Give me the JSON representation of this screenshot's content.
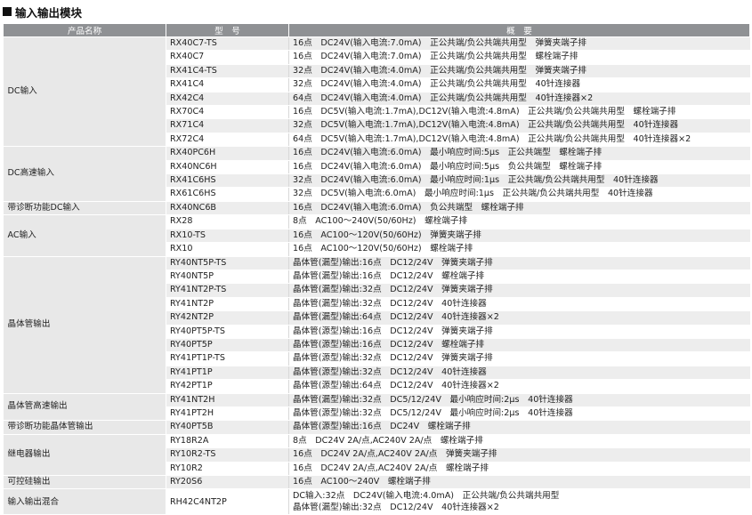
{
  "title": "输入输出模块",
  "headers": [
    "产品名称",
    "型　号",
    "概　要"
  ],
  "groups": [
    {
      "name": "DC输入",
      "rows": [
        {
          "model": "RX40C7-TS",
          "summary": [
            "16点　DC24V(输入电流:7.0mA)　正公共端/负公共端共用型　弹簧夹端子排"
          ]
        },
        {
          "model": "RX40C7",
          "summary": [
            "16点　DC24V(输入电流:7.0mA)　正公共端/负公共端共用型　螺栓端子排"
          ]
        },
        {
          "model": "RX41C4-TS",
          "summary": [
            "32点　DC24V(输入电流:4.0mA)　正公共端/负公共端共用型　弹簧夹端子排"
          ]
        },
        {
          "model": "RX41C4",
          "summary": [
            "32点　DC24V(输入电流:4.0mA)　正公共端/负公共端共用型　40针连接器"
          ]
        },
        {
          "model": "RX42C4",
          "summary": [
            "64点　DC24V(输入电流:4.0mA)　正公共端/负公共端共用型　40针连接器×2"
          ]
        },
        {
          "model": "RX70C4",
          "summary": [
            "16点　DC5V(输入电流:1.7mA),DC12V(输入电流:4.8mA)　正公共端/负公共端共用型　螺栓端子排"
          ]
        },
        {
          "model": "RX71C4",
          "summary": [
            "32点　DC5V(输入电流:1.7mA),DC12V(输入电流:4.8mA)　正公共端/负公共端共用型　40针连接器"
          ]
        },
        {
          "model": "RX72C4",
          "summary": [
            "64点　DC5V(输入电流:1.7mA),DC12V(输入电流:4.8mA)　正公共端/负公共端共用型　40针连接器×2"
          ]
        }
      ]
    },
    {
      "name": "DC高速输入",
      "rows": [
        {
          "model": "RX40PC6H",
          "summary": [
            "16点　DC24V(输入电流:6.0mA)　最小响应时间:5μs　正公共端型　螺栓端子排"
          ]
        },
        {
          "model": "RX40NC6H",
          "summary": [
            "16点　DC24V(输入电流:6.0mA)　最小响应时间:5μs　负公共端型　螺栓端子排"
          ]
        },
        {
          "model": "RX41C6HS",
          "summary": [
            "32点　DC24V(输入电流:6.0mA)　最小响应时间:1μs　正公共端/负公共端共用型　40针连接器"
          ]
        },
        {
          "model": "RX61C6HS",
          "summary": [
            "32点　DC5V(输入电流:6.0mA)　最小响应时间:1μs　正公共端/负公共端共用型　40针连接器"
          ]
        }
      ]
    },
    {
      "name": "带诊断功能DC输入",
      "rows": [
        {
          "model": "RX40NC6B",
          "summary": [
            "16点　DC24V(输入电流:6.0mA)　负公共端型　螺栓端子排"
          ]
        }
      ]
    },
    {
      "name": "AC输入",
      "rows": [
        {
          "model": "RX28",
          "summary": [
            "8点　AC100～240V(50/60Hz)　螺栓端子排"
          ]
        },
        {
          "model": "RX10-TS",
          "summary": [
            "16点　AC100～120V(50/60Hz)　弹簧夹端子排"
          ]
        },
        {
          "model": "RX10",
          "summary": [
            "16点　AC100～120V(50/60Hz)　螺栓端子排"
          ]
        }
      ]
    },
    {
      "name": "晶体管输出",
      "rows": [
        {
          "model": "RY40NT5P-TS",
          "summary": [
            "晶体管(漏型)输出:16点　DC12/24V　弹簧夹端子排"
          ]
        },
        {
          "model": "RY40NT5P",
          "summary": [
            "晶体管(漏型)输出:16点　DC12/24V　螺栓端子排"
          ]
        },
        {
          "model": "RY41NT2P-TS",
          "summary": [
            "晶体管(漏型)输出:32点　DC12/24V　弹簧夹端子排"
          ]
        },
        {
          "model": "RY41NT2P",
          "summary": [
            "晶体管(漏型)输出:32点　DC12/24V　40针连接器"
          ]
        },
        {
          "model": "RY42NT2P",
          "summary": [
            "晶体管(漏型)输出:64点　DC12/24V　40针连接器×2"
          ]
        },
        {
          "model": "RY40PT5P-TS",
          "summary": [
            "晶体管(源型)输出:16点　DC12/24V　弹簧夹端子排"
          ]
        },
        {
          "model": "RY40PT5P",
          "summary": [
            "晶体管(源型)输出:16点　DC12/24V　螺栓端子排"
          ]
        },
        {
          "model": "RY41PT1P-TS",
          "summary": [
            "晶体管(源型)输出:32点　DC12/24V　弹簧夹端子排"
          ]
        },
        {
          "model": "RY41PT1P",
          "summary": [
            "晶体管(源型)输出:32点　DC12/24V　40针连接器"
          ]
        },
        {
          "model": "RY42PT1P",
          "summary": [
            "晶体管(源型)输出:64点　DC12/24V　40针连接器×2"
          ]
        }
      ]
    },
    {
      "name": "晶体管高速输出",
      "rows": [
        {
          "model": "RY41NT2H",
          "summary": [
            "晶体管(漏型)输出:32点　DC5/12/24V　最小响应时间:2μs　40针连接器"
          ]
        },
        {
          "model": "RY41PT2H",
          "summary": [
            "晶体管(源型)输出:32点　DC5/12/24V　最小响应时间:2μs　40针连接器"
          ]
        }
      ]
    },
    {
      "name": "带诊断功能晶体管输出",
      "rows": [
        {
          "model": "RY40PT5B",
          "summary": [
            "晶体管(源型)输出:16点　DC24V　螺栓端子排"
          ]
        }
      ]
    },
    {
      "name": "继电器输出",
      "rows": [
        {
          "model": "RY18R2A",
          "summary": [
            "8点　DC24V 2A/点,AC240V 2A/点　螺栓端子排"
          ]
        },
        {
          "model": "RY10R2-TS",
          "summary": [
            "16点　DC24V 2A/点,AC240V 2A/点　弹簧夹端子排"
          ]
        },
        {
          "model": "RY10R2",
          "summary": [
            "16点　DC24V 2A/点,AC240V 2A/点　螺栓端子排"
          ]
        }
      ]
    },
    {
      "name": "可控硅输出",
      "rows": [
        {
          "model": "RY20S6",
          "summary": [
            "16点　AC100～240V　螺栓端子排"
          ]
        }
      ]
    },
    {
      "name": "输入输出混合",
      "rows": [
        {
          "model": "RH42C4NT2P",
          "summary": [
            "DC输入:32点　DC24V(输入电流:4.0mA)　正公共端/负公共端共用型",
            "晶体管(漏型)输出:32点　DC12/24V　40针连接器×2"
          ]
        }
      ]
    }
  ]
}
